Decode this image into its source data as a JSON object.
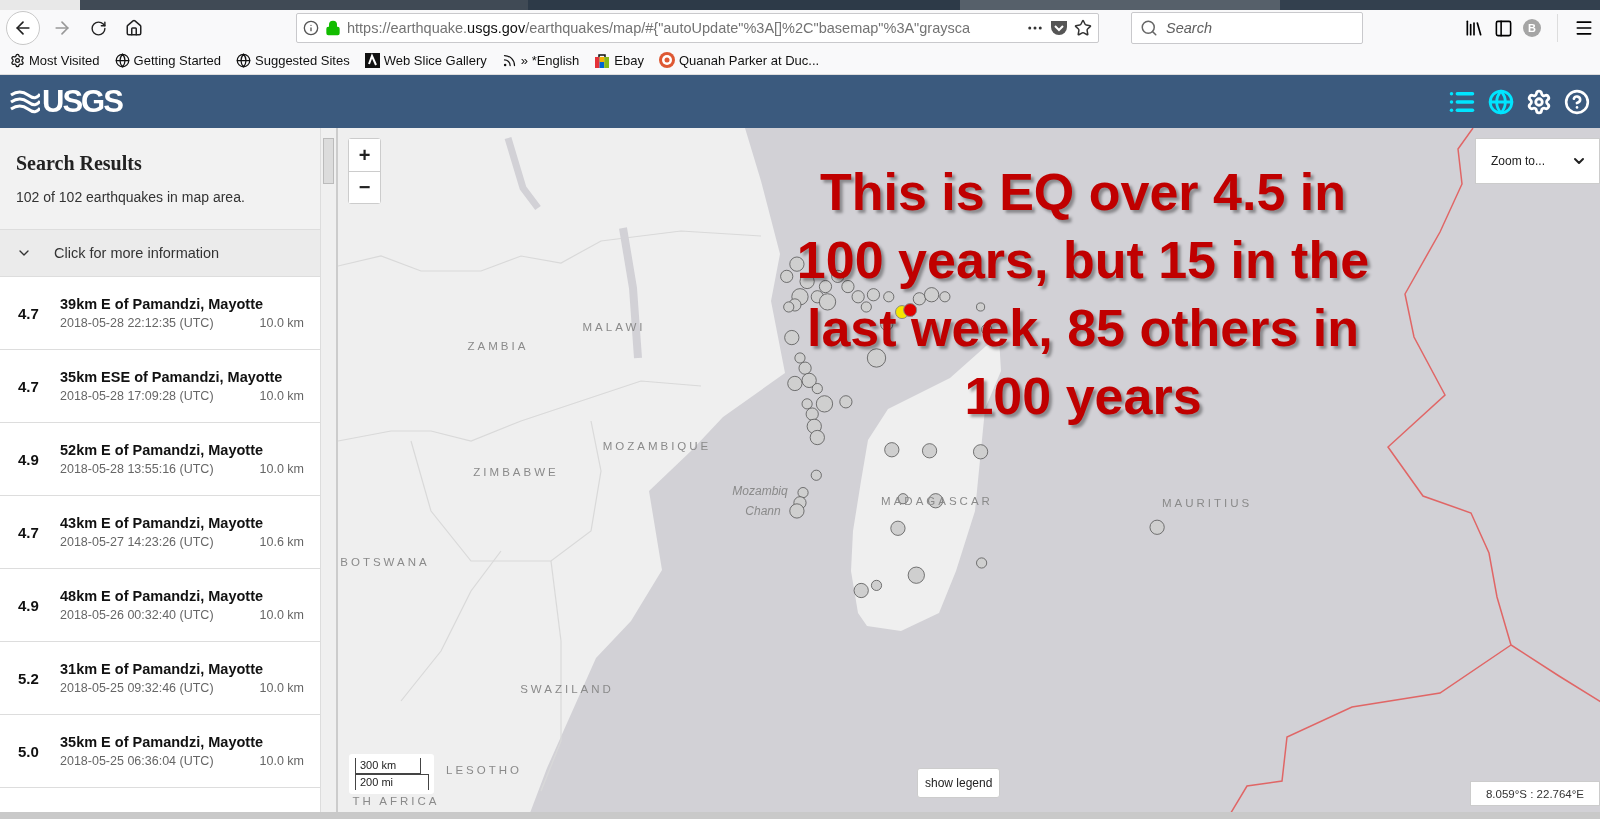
{
  "browser": {
    "url_prefix": "https://earthquake.",
    "url_host": "usgs.gov",
    "url_path": "/earthquakes/map/#{\"autoUpdate\"%3A[]%2C\"basemap\"%3A\"graysca",
    "search_placeholder": "Search",
    "avatar": "B",
    "bookmarks": [
      {
        "label": "Most Visited",
        "kind": "gear"
      },
      {
        "label": "Getting Started",
        "kind": "globe"
      },
      {
        "label": "Suggested Sites",
        "kind": "globe"
      },
      {
        "label": "Web Slice Gallery",
        "kind": "slice"
      },
      {
        "label": "» *English",
        "kind": "feed"
      },
      {
        "label": "Ebay",
        "kind": "bag"
      },
      {
        "label": "Quanah Parker at Duc...",
        "kind": "duck"
      }
    ]
  },
  "header": {
    "logo": "USGS"
  },
  "sidebar": {
    "title": "Search Results",
    "summary": "102 of 102 earthquakes in map area.",
    "more_info": "Click for more information",
    "results": [
      {
        "magnitude": "4.7",
        "place": "39km E of Pamandzi, Mayotte",
        "time": "2018-05-28 22:12:35 (UTC)",
        "depth": "10.0 km"
      },
      {
        "magnitude": "4.7",
        "place": "35km ESE of Pamandzi, Mayotte",
        "time": "2018-05-28 17:09:28 (UTC)",
        "depth": "10.0 km"
      },
      {
        "magnitude": "4.9",
        "place": "52km E of Pamandzi, Mayotte",
        "time": "2018-05-28 13:55:16 (UTC)",
        "depth": "10.0 km"
      },
      {
        "magnitude": "4.7",
        "place": "43km E of Pamandzi, Mayotte",
        "time": "2018-05-27 14:23:26 (UTC)",
        "depth": "10.6 km"
      },
      {
        "magnitude": "4.9",
        "place": "48km E of Pamandzi, Mayotte",
        "time": "2018-05-26 00:32:40 (UTC)",
        "depth": "10.0 km"
      },
      {
        "magnitude": "5.2",
        "place": "31km E of Pamandzi, Mayotte",
        "time": "2018-05-25 09:32:46 (UTC)",
        "depth": "10.0 km"
      },
      {
        "magnitude": "5.0",
        "place": "35km E of Pamandzi, Mayotte",
        "time": "2018-05-25 06:36:04 (UTC)",
        "depth": "10.0 km"
      }
    ]
  },
  "map": {
    "zoom_in": "+",
    "zoom_out": "−",
    "zoom_to": "Zoom to...",
    "labels": [
      {
        "text": "ZAMBIA",
        "kind": "country"
      },
      {
        "text": "MALAWI",
        "kind": "country"
      },
      {
        "text": "MOZAMBIQUE",
        "kind": "country"
      },
      {
        "text": "ZIMBABWE",
        "kind": "country"
      },
      {
        "text": "BOTSWANA",
        "kind": "country"
      },
      {
        "text": "SWAZILAND",
        "kind": "country"
      },
      {
        "text": "LESOTHO",
        "kind": "country"
      },
      {
        "text": "TH AFRICA",
        "kind": "country"
      },
      {
        "text": "Mozambiq",
        "kind": "sea"
      },
      {
        "text": "Chann",
        "kind": "sea"
      },
      {
        "text": "MADAGASCAR",
        "kind": "country"
      },
      {
        "text": "MAURITIUS",
        "kind": "country"
      }
    ],
    "annotation": [
      "This is EQ over 4.5 in",
      "100 years, but 15 in the",
      "last week, 85 others in",
      "100 years"
    ],
    "scale": {
      "metric": "300 km",
      "imperial": "200 mi"
    },
    "legend_button": "show legend",
    "coordinates": "8.059°S : 22.764°E"
  }
}
